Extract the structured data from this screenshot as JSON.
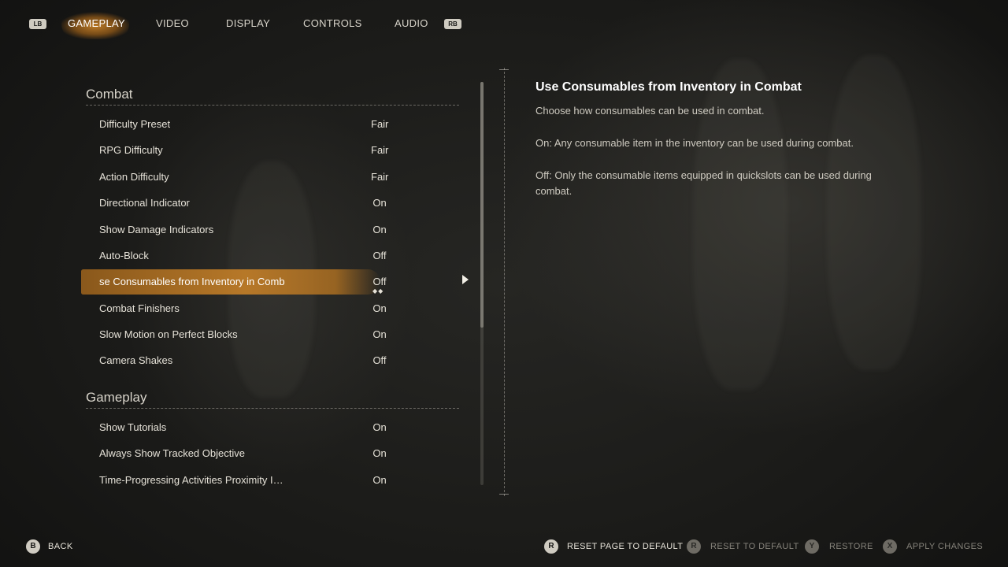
{
  "tabs": {
    "left_bumper": "LB",
    "right_bumper": "RB",
    "items": [
      {
        "label": "GAMEPLAY",
        "active": true
      },
      {
        "label": "VIDEO",
        "active": false
      },
      {
        "label": "DISPLAY",
        "active": false
      },
      {
        "label": "CONTROLS",
        "active": false
      },
      {
        "label": "AUDIO",
        "active": false
      }
    ]
  },
  "sections": {
    "combat": {
      "header": "Combat",
      "rows": [
        {
          "label": "Difficulty Preset",
          "value": "Fair"
        },
        {
          "label": "RPG Difficulty",
          "value": "Fair"
        },
        {
          "label": "Action Difficulty",
          "value": "Fair"
        },
        {
          "label": "Directional Indicator",
          "value": "On"
        },
        {
          "label": "Show Damage Indicators",
          "value": "On"
        },
        {
          "label": "Auto-Block",
          "value": "Off"
        },
        {
          "label": "se Consumables from Inventory in Comb",
          "value": "Off",
          "selected": true
        },
        {
          "label": "Combat Finishers",
          "value": "On"
        },
        {
          "label": "Slow Motion on Perfect Blocks",
          "value": "On"
        },
        {
          "label": "Camera Shakes",
          "value": "Off"
        }
      ]
    },
    "gameplay": {
      "header": "Gameplay",
      "rows": [
        {
          "label": "Show Tutorials",
          "value": "On"
        },
        {
          "label": "Always Show Tracked Objective",
          "value": "On"
        },
        {
          "label": "Time-Progressing Activities Proximity I…",
          "value": "On"
        }
      ]
    }
  },
  "selected_indicator": "◆◆",
  "description": {
    "title": "Use Consumables from Inventory in Combat",
    "paragraphs": [
      "Choose how consumables can be used in combat.",
      "On: Any consumable item in the inventory can be used during combat.",
      "Off: Only the consumable items equipped in quickslots can be used during combat."
    ]
  },
  "footer": {
    "back": {
      "button": "B",
      "label": "BACK"
    },
    "reset_page": {
      "button": "R",
      "label": "RESET PAGE TO DEFAULT"
    },
    "reset_default": {
      "button": "R",
      "label": "RESET TO DEFAULT"
    },
    "restore": {
      "button": "Y",
      "label": "RESTORE"
    },
    "apply": {
      "button": "X",
      "label": "APPLY CHANGES"
    }
  },
  "colors": {
    "accent": "#be7c28",
    "background": "#1e1e1c",
    "text": "#e6e2d8"
  }
}
